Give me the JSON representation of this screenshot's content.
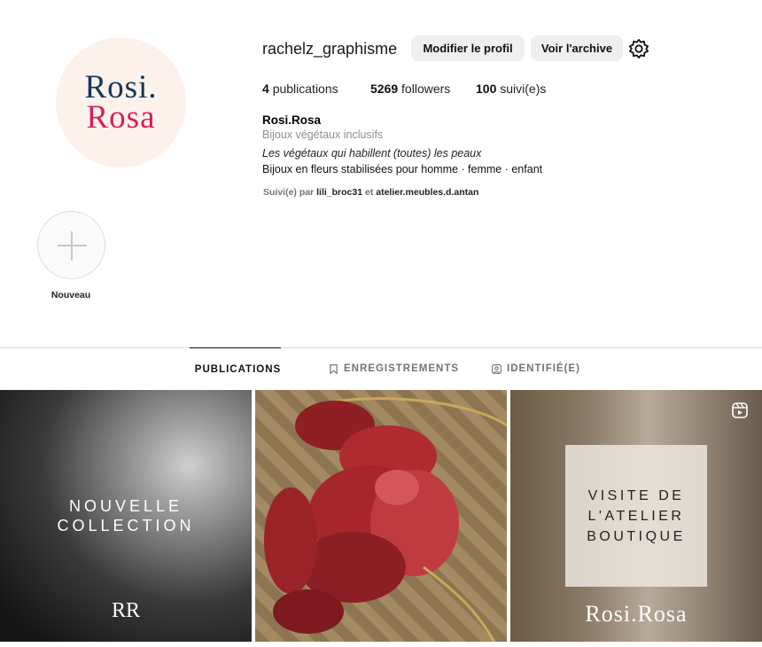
{
  "profile": {
    "username": "rachelz_graphisme",
    "avatar_line1": "Rosi.",
    "avatar_line2": "Rosa",
    "edit_label": "Modifier le profil",
    "archive_label": "Voir l'archive",
    "settings_icon": "gear-icon"
  },
  "stats": {
    "posts_count": "4",
    "posts_label": "publications",
    "followers_count": "5269",
    "followers_label": "followers",
    "following_count": "100",
    "following_label": "suivi(e)s"
  },
  "bio": {
    "name": "Rosi.Rosa",
    "category": "Bijoux végétaux inclusifs",
    "line1": "Les végétaux qui habillent (toutes) les peaux",
    "line2": "Bijoux en fleurs stabilisées pour homme · femme · enfant",
    "followed_prefix": "Suivi(e) par",
    "followed_user1": "lili_broc31",
    "followed_sep": "et",
    "followed_user2": "atelier.meubles.d.antan"
  },
  "highlight": {
    "label": "Nouveau"
  },
  "tabs": [
    {
      "label": "PUBLICATIONS",
      "icon": "grid-icon",
      "active": true
    },
    {
      "label": "ENREGISTREMENTS",
      "icon": "bookmark-icon",
      "active": false
    },
    {
      "label": "IDENTIFIÉ(E)",
      "icon": "tag-icon",
      "active": false
    }
  ],
  "posts": [
    {
      "overlay_line1": "NOUVELLE",
      "overlay_line2": "COLLECTION",
      "monogram": "RR"
    },
    {},
    {
      "card_line1": "VISITE DE",
      "card_line2": "L'ATELIER",
      "card_line3": "BOUTIQUE",
      "brand": "Rosi.Rosa",
      "reel_icon": "reel-icon"
    }
  ],
  "colors": {
    "accent_navy": "#14365a",
    "accent_pink": "#d81f5a"
  }
}
